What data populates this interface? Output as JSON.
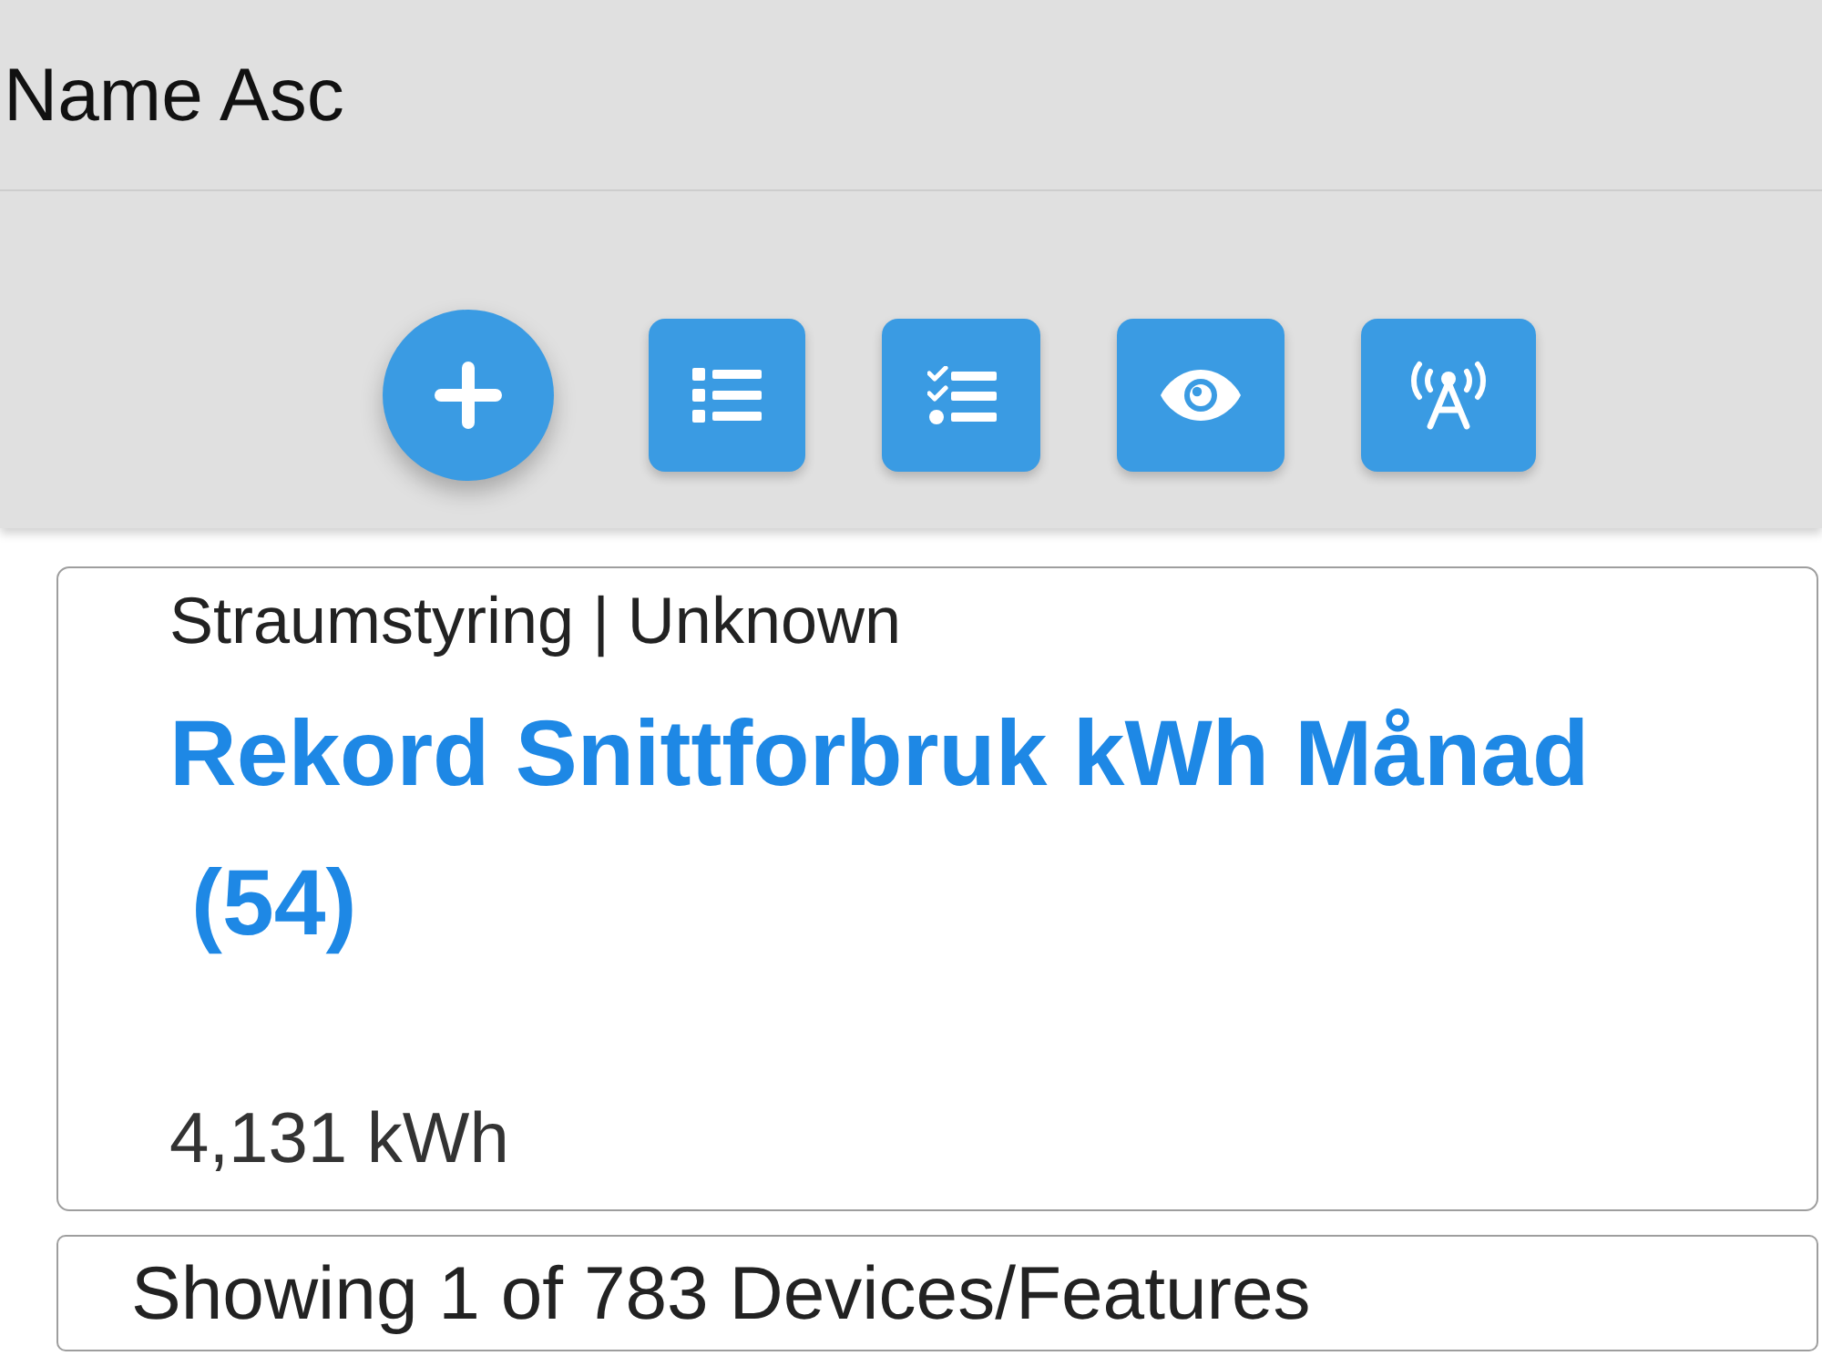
{
  "sort": {
    "label": "Name Asc"
  },
  "toolbar": {
    "buttons": [
      {
        "kind": "add"
      },
      {
        "kind": "list"
      },
      {
        "kind": "select"
      },
      {
        "kind": "view"
      },
      {
        "kind": "broadcast"
      }
    ]
  },
  "device_card": {
    "subtitle": "Straumstyring | Unknown",
    "title": "Rekord Snittforbruk kWh Månad",
    "count": "(54)",
    "value": "4,131 kWh"
  },
  "footer": {
    "text": "Showing 1 of 783 Devices/Features"
  }
}
